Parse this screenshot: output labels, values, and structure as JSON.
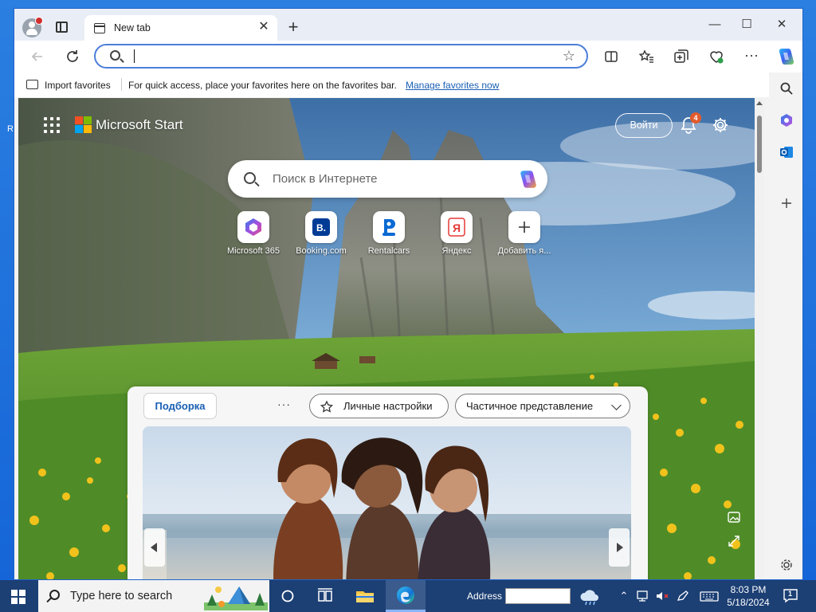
{
  "desktop": {
    "edge_letter": "R"
  },
  "tab": {
    "title": "New tab",
    "close_glyph": "✕"
  },
  "window_controls": {
    "minimize": "—",
    "maximize": "☐",
    "close": "✕"
  },
  "toolbar": {
    "address_value": ""
  },
  "favorites_bar": {
    "import_label": "Import favorites",
    "message": "For quick access, place your favorites here on the favorites bar.",
    "manage_link": "Manage favorites now"
  },
  "newtab": {
    "brand": "Microsoft Start",
    "signin_label": "Войти",
    "notification_count": "4",
    "search_placeholder": "Поиск в Интернете",
    "quick_links": [
      {
        "label": "Microsoft 365",
        "icon": "microsoft-365-icon"
      },
      {
        "label": "Booking.com",
        "icon": "booking-icon"
      },
      {
        "label": "Rentalcars",
        "icon": "rentalcars-icon"
      },
      {
        "label": "Яндекс",
        "icon": "yandex-icon"
      },
      {
        "label": "Добавить я...",
        "icon": "plus-icon"
      }
    ]
  },
  "feed": {
    "tab_label": "Подборка",
    "more_glyph": "···",
    "personalize_label": "Личные настройки",
    "view_label": "Частичное представление"
  },
  "taskbar": {
    "search_placeholder": "Type here to search",
    "address_label": "Address",
    "time": "8:03 PM",
    "date": "5/18/2024",
    "notification_count": "1"
  },
  "colors": {
    "accent": "#1a5fb4",
    "address_border": "#4c7fd9",
    "taskbar": "#1c3f74",
    "badge": "#e25b2c"
  }
}
